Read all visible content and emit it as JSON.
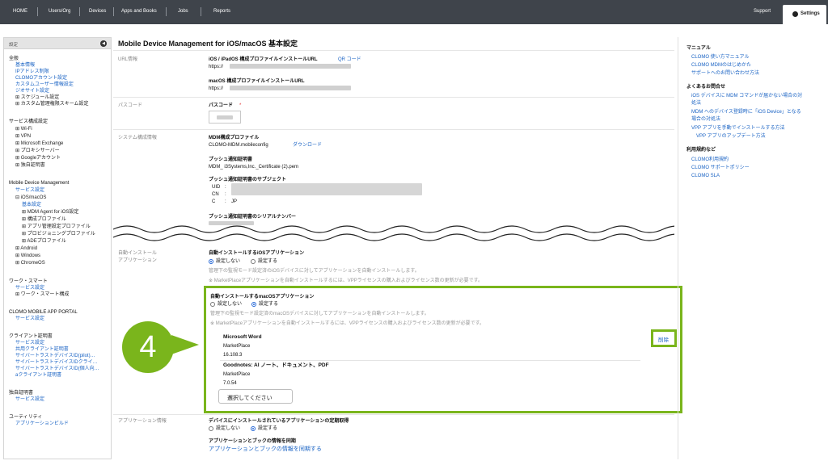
{
  "topnav": {
    "items": [
      "HOME",
      "Users/Org",
      "Devices",
      "Apps and Books",
      "Jobs",
      "Reports"
    ],
    "support": "Support",
    "settings": "Settings"
  },
  "sidebar": {
    "header": "設定",
    "groups": [
      {
        "title": "全般",
        "items": [
          {
            "label": "基本情報",
            "kind": "link"
          },
          {
            "label": "IPアドレス制限",
            "kind": "link"
          },
          {
            "label": "CLOMOアカウント設定",
            "kind": "link"
          },
          {
            "label": "カスタムユーザー情報設定",
            "kind": "link"
          },
          {
            "label": "ジオサイト設定",
            "kind": "link"
          },
          {
            "label": "⊞ スケジュール設定",
            "kind": "text"
          },
          {
            "label": "⊞ カスタム管理権限スキーム設定",
            "kind": "text"
          }
        ]
      },
      {
        "title": "サービス構成設定",
        "items": [
          {
            "label": "⊞ Wi-Fi",
            "kind": "text"
          },
          {
            "label": "⊞ VPN",
            "kind": "text"
          },
          {
            "label": "⊞ Microsoft Exchange",
            "kind": "text"
          },
          {
            "label": "⊞ プロキシサーバー",
            "kind": "text"
          },
          {
            "label": "⊞ Googleアカウント",
            "kind": "text"
          },
          {
            "label": "⊞ 独自証明書",
            "kind": "text"
          }
        ]
      },
      {
        "title": "Mobile Device Management",
        "items": [
          {
            "label": "サービス設定",
            "kind": "link"
          },
          {
            "label": "⊟ iOS/macOS",
            "kind": "text"
          },
          {
            "label": "基本設定",
            "kind": "link"
          },
          {
            "label": "⊞ MDM Agent for iOS設定",
            "kind": "text"
          },
          {
            "label": "⊞ 構成プロファイル",
            "kind": "text"
          },
          {
            "label": "⊞ アプリ管理設定プロファイル",
            "kind": "text"
          },
          {
            "label": "⊞ プロビジョニングプロファイル",
            "kind": "text"
          },
          {
            "label": "⊞ ADEプロファイル",
            "kind": "text"
          },
          {
            "label": "⊞ Android",
            "kind": "text"
          },
          {
            "label": "⊞ Windows",
            "kind": "text"
          },
          {
            "label": "⊞ ChromeOS",
            "kind": "text"
          }
        ]
      },
      {
        "title": "ワーク・スマート",
        "items": [
          {
            "label": "サービス設定",
            "kind": "link"
          },
          {
            "label": "⊞ ワーク・スマート構成",
            "kind": "text"
          }
        ]
      },
      {
        "title": "CLOMO MOBILE APP PORTAL",
        "items": [
          {
            "label": "サービス設定",
            "kind": "link"
          }
        ]
      },
      {
        "title": "クライアント証明書",
        "items": [
          {
            "label": "サービス設定",
            "kind": "link"
          },
          {
            "label": "共用クライアント証明書",
            "kind": "link"
          },
          {
            "label": "サイバートラストデバイスID(pilot)…",
            "kind": "link"
          },
          {
            "label": "サイバートラストデバイスIDクライ…",
            "kind": "link"
          },
          {
            "label": "サイバートラストデバイスID(個人向…",
            "kind": "link"
          },
          {
            "label": "aクライアント証明書",
            "kind": "link"
          }
        ]
      },
      {
        "title": "独自証明書",
        "items": [
          {
            "label": "サービス設定",
            "kind": "link"
          }
        ]
      },
      {
        "title": "ユーティリティ",
        "items": [
          {
            "label": "アプリケーションビルド",
            "kind": "link"
          }
        ]
      }
    ]
  },
  "main": {
    "title": "Mobile Device Management for iOS/macOS 基本設定",
    "url_section": {
      "label": "URL情報",
      "ios_label": "iOS / iPadOS 構成プロファイルインストールURL",
      "qr": "QR コード",
      "ios_url": "https://",
      "mac_label": "macOS 構成プロファイルインストールURL",
      "mac_url": "https://"
    },
    "passcode": {
      "label": "パスコード",
      "field_label": "パスコード",
      "required": "*"
    },
    "system": {
      "label": "システム構成情報",
      "mdm_profile": "MDM構成プロファイル",
      "mdm_file": "CLOMO-MDM.mobileconfig",
      "download": "ダウンロード",
      "push_cert": "プッシュ通知証明書",
      "push_file": "MDM_ i3Systems,Inc._Certificate (2).pem",
      "subject": "プッシュ通知証明書のサブジェクト",
      "uid": "UID",
      "cn": "CN",
      "c": "C",
      "colon": ":",
      "c_value": "JP",
      "serial": "プッシュ通知証明書のシリアルナンバー"
    },
    "auto_install": {
      "label": "自動インストール\nアプリケーション",
      "label1": "自動インストール",
      "label2": "アプリケーション",
      "ios_title": "自動インストールするiOSアプリケーション",
      "ios_off": "設定しない",
      "ios_on": "設定する",
      "ios_selected": "off",
      "ios_note1": "管理下の監視モード設定済のiOSデバイスに対してアプリケーションを自動インストールします。",
      "ios_note2": "※ MarketPlaceアプリケーションを自動インストールするには、VPPライセンスの購入およびライセンス数の更新が必要です。",
      "mac_title": "自動インストールするmacOSアプリケーション",
      "mac_off": "設定しない",
      "mac_on": "設定する",
      "mac_selected": "on",
      "mac_note1": "管理下の監視モード設定済のmacOSデバイスに対してアプリケーションを自動インストールします。",
      "mac_note2": "※ MarketPlaceアプリケーションを自動インストールするには、VPPライセンスの購入およびライセンス数の更新が必要です。",
      "apps": [
        {
          "name": "Microsoft Word",
          "source": "MarketPlace",
          "version": "16.108.3"
        },
        {
          "name": "Goodnotes: AI ノート、ドキュメント、PDF",
          "source": "MarketPlace",
          "version": "7.0.54"
        }
      ],
      "delete": "削除",
      "select_placeholder": "選択してください",
      "select_chevron": "⌄"
    },
    "app_info": {
      "label": "アプリケーション情報",
      "periodic_title": "デバイスにインストールされているアプリケーションの定期取得",
      "off": "設定しない",
      "on": "設定する",
      "selected": "on",
      "sync_title": "アプリケーションとブックの情報を同期",
      "sync_link": "アプリケーションとブックの情報を同期する"
    },
    "step_number": "4"
  },
  "right": {
    "manual_title": "マニュアル",
    "manual_links": [
      "CLOMO 使い方マニュアル",
      "CLOMO MDMのはじめかた",
      "サポートへのお問い合わせ方法"
    ],
    "faq_title": "よくあるお問合せ",
    "faq_links": [
      "iOS デバイスに MDM コマンドが届かない場合の対",
      "処法",
      "MDM へのデバイス登録時に「iOS Device」となる",
      "場合の対処法",
      "VPP アプリを手動でインストールする方法",
      "　VPP アプリのアップデート方法"
    ],
    "terms_title": "利用規約など",
    "terms_links": [
      "CLOMO利用規約",
      "CLOMO サポートポリシー",
      "CLOMO SLA"
    ]
  },
  "colors": {
    "accent": "#7ab51c",
    "link": "#1a63c4",
    "nav_bg": "#3f444b"
  }
}
